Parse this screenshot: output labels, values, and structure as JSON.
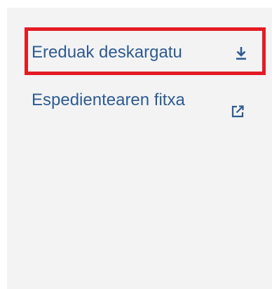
{
  "links": {
    "download_templates": {
      "label": "Ereduak deskargatu",
      "icon": "download-icon"
    },
    "file_record": {
      "label": "Espedientearen fitxa",
      "icon": "external-link-icon"
    }
  },
  "colors": {
    "panel_background": "#f3f3f4",
    "link": "#2e5b8f",
    "highlight_border": "#e31b23"
  }
}
